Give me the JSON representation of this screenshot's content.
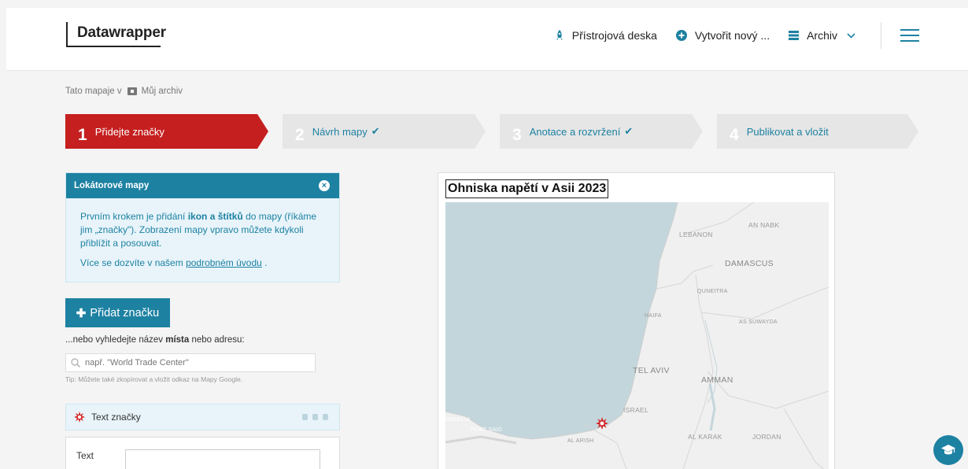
{
  "header": {
    "logo": "Datawrapper",
    "nav": {
      "dashboard": "Přístrojová deska",
      "create": "Vytvořit nový ...",
      "archive": "Archiv"
    }
  },
  "breadcrumb": {
    "prefix": "Tato mapaje v",
    "folder": "Můj archiv"
  },
  "steps": [
    {
      "num": "1",
      "label": "Přidejte značky"
    },
    {
      "num": "2",
      "label": "Návrh mapy"
    },
    {
      "num": "3",
      "label": "Anotace a rozvržení"
    },
    {
      "num": "4",
      "label": "Publikovat a vložit"
    }
  ],
  "info": {
    "title": "Lokátorové mapy",
    "p1_a": "Prvním krokem je přidání ",
    "p1_bold": "ikon a štítků",
    "p1_b": " do mapy (říkáme jim „značky\"). Zobrazení mapy vpravo můžete kdykoli přiblížit a posouvat.",
    "p2_a": "Více se dozvíte v našem ",
    "p2_link": "podrobném úvodu",
    "p2_b": " ."
  },
  "add_marker": {
    "label": "Přidat značku",
    "search_prefix": "...nebo vyhledejte název ",
    "search_bold": "místa",
    "search_suffix": " nebo adresu:",
    "placeholder": "např. \"World Trade Center\"",
    "tip": "Tip: Můžete také zkopírovat a vložit odkaz na Mapy Google."
  },
  "marker": {
    "label": "Text značky",
    "text_label": "Text"
  },
  "preview": {
    "title": "Ohniska napětí v Asii 2023",
    "places": {
      "lebanon": "LEBANON",
      "an_nabk": "AN NABK",
      "damascus": "DAMASCUS",
      "quneitra": "QUNEITRA",
      "haifa": "HAIFA",
      "as_suwayda": "AS SUWAYDA",
      "tel_aviv": "TEL AVIV",
      "amman": "AMMAN",
      "israel": "ISRAEL",
      "ismailia": "ISMAILIA",
      "port_said": "PORT SAID",
      "al_arish": "AL ARISH",
      "al_karak": "AL KARAK",
      "jordan": "JORDAN"
    }
  },
  "colors": {
    "brand_blue": "#1d81a2",
    "active_step": "#c51f1f",
    "marker_red": "#d41e1e",
    "sea": "#c3d6dc",
    "land": "#f0f0f0"
  }
}
